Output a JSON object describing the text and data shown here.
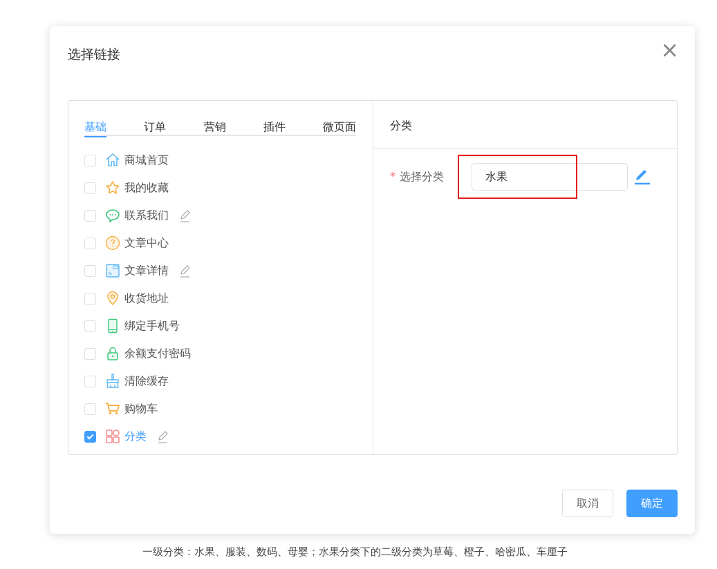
{
  "dialog": {
    "title": "选择链接",
    "close": "×"
  },
  "tabs": [
    {
      "label": "基础",
      "selected": true
    },
    {
      "label": "订单",
      "selected": false
    },
    {
      "label": "营销",
      "selected": false
    },
    {
      "label": "插件",
      "selected": false
    },
    {
      "label": "微页面",
      "selected": false
    }
  ],
  "links": [
    {
      "label": "商城首页",
      "checked": false,
      "editable": false
    },
    {
      "label": "我的收藏",
      "checked": false,
      "editable": false
    },
    {
      "label": "联系我们",
      "checked": false,
      "editable": true
    },
    {
      "label": "文章中心",
      "checked": false,
      "editable": false
    },
    {
      "label": "文章详情",
      "checked": false,
      "editable": true
    },
    {
      "label": "收货地址",
      "checked": false,
      "editable": false
    },
    {
      "label": "绑定手机号",
      "checked": false,
      "editable": false
    },
    {
      "label": "余额支付密码",
      "checked": false,
      "editable": false
    },
    {
      "label": "清除缓存",
      "checked": false,
      "editable": false
    },
    {
      "label": "购物车",
      "checked": false,
      "editable": false
    },
    {
      "label": "分类",
      "checked": true,
      "editable": true
    }
  ],
  "detail": {
    "heading": "分类",
    "field": {
      "label": "选择分类",
      "required": "*",
      "value": "水果",
      "highlighted": true
    }
  },
  "buttons": [
    {
      "label": "取消",
      "kind": "secondary"
    },
    {
      "label": "确定",
      "kind": "primary"
    }
  ],
  "caption": "一级分类：水果、服装、数码、母婴；水果分类下的二级分类为草莓、橙子、哈密瓜、车厘子"
}
